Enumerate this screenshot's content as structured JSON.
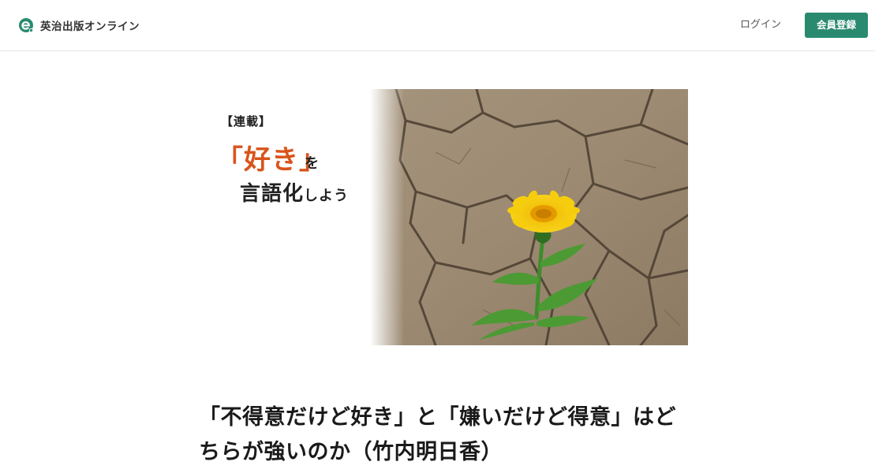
{
  "header": {
    "site_name": "英治出版オンライン",
    "login_label": "ログイン",
    "signup_label": "会員登録",
    "brand_color": "#2a8a70",
    "logo_icon": "e-logo-icon"
  },
  "hero": {
    "series_tag": "【連載】",
    "title_line1": "「好き」",
    "title_wo": "を",
    "title_line2_main": "言語化",
    "title_line2_small": "しよう",
    "accent_color": "#d9541b",
    "image_subject": "dandelion-in-cracked-earth"
  },
  "article": {
    "title": "「不得意だけど好き」と「嫌いだけど得意」はどちらが強いのか（竹内明日香）"
  }
}
